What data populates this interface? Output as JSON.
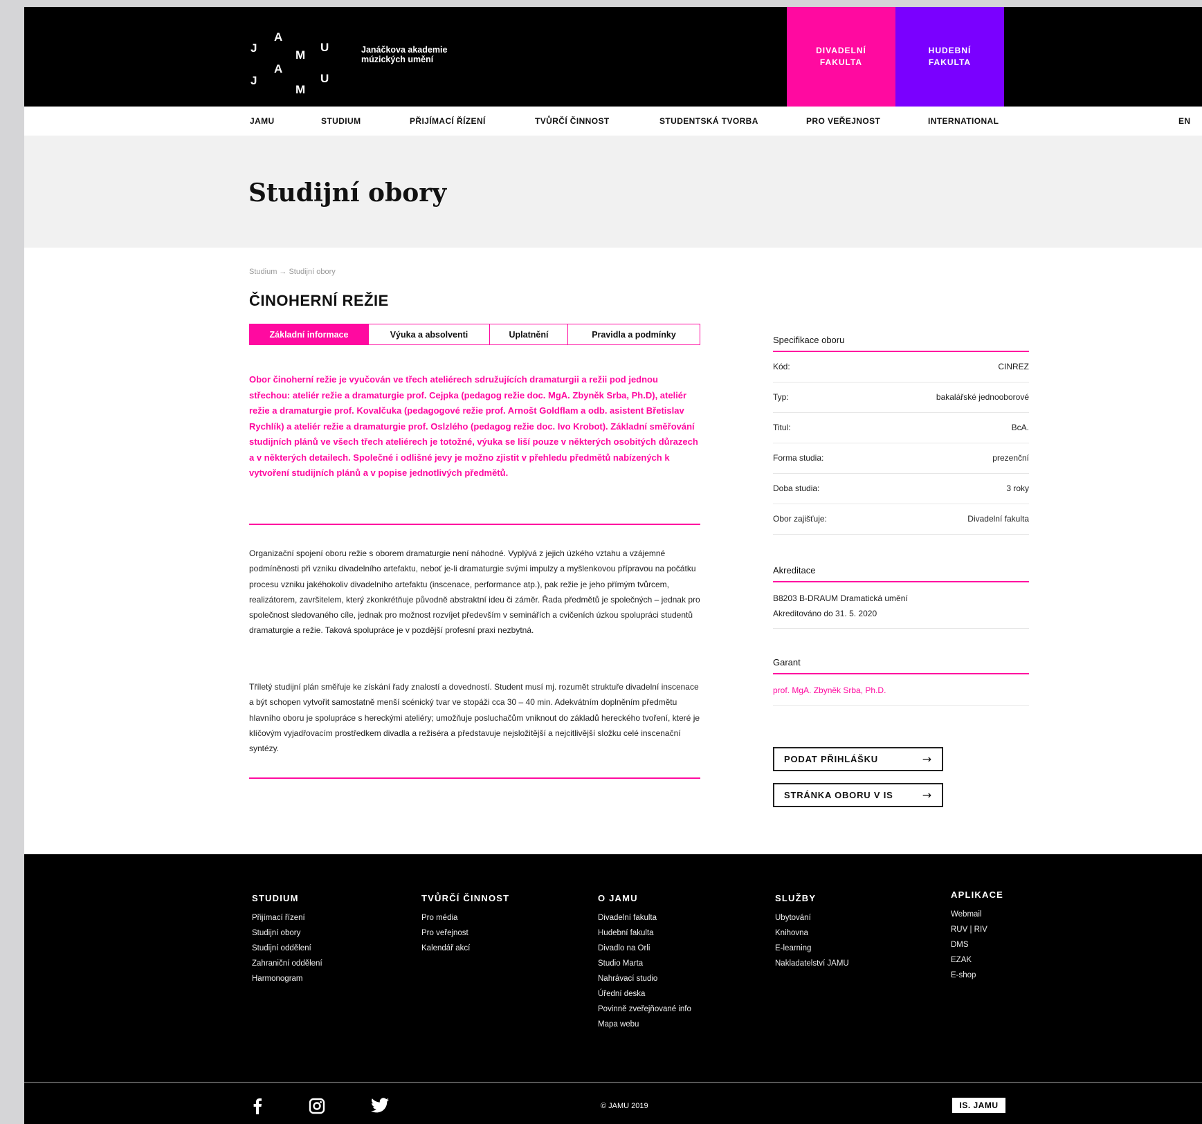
{
  "logo": {
    "letters": [
      "J",
      "A",
      "M",
      "U",
      "J",
      "A",
      "M",
      "U"
    ],
    "name_line1": "Janáčkova akademie",
    "name_line2": "múzických umění"
  },
  "faculties": {
    "theatre": [
      "DIVADELNÍ",
      "FAKULTA"
    ],
    "music": [
      "HUDEBNÍ",
      "FAKULTA"
    ]
  },
  "nav": {
    "items": [
      "JAMU",
      "STUDIUM",
      "PŘIJÍMACÍ ŘÍZENÍ",
      "TVŮRČÍ ČINNOST",
      "STUDENTSKÁ TVORBA",
      "PRO VEŘEJNOST",
      "INTERNATIONAL"
    ],
    "lang": "EN"
  },
  "hero": {
    "title": "Studijní obory"
  },
  "breadcrumb": "Studium → Studijní obory",
  "field": {
    "title": "ČINOHERNÍ REŽIE"
  },
  "tabs": [
    "Základní informace",
    "Výuka a absolventi",
    "Uplatnění",
    "Pravidla a podmínky"
  ],
  "lead": "Obor činoherní režie je vyučován ve třech ateliérech sdružujících dramaturgii a režii pod jednou střechou: ateliér režie a dramaturgie prof. Cejpka (pedagog režie doc. MgA. Zbyněk Srba, Ph.D), ateliér režie a dramaturgie prof. Kovalčuka (pedagogové režie prof. Arnošt Goldflam a odb. asistent Břetislav Rychlík) a ateliér režie a dramaturgie prof. Oslzlého (pedagog režie doc. Ivo Krobot). Základní směřování studijních plánů ve všech třech ateliérech je totožné, výuka se liší pouze v některých osobitých důrazech a v některých detailech. Společné i odlišné jevy je možno zjistit v přehledu předmětů nabízených k vytvoření studijních plánů a v popise jednotlivých předmětů.",
  "paragraphs": [
    "Organizační spojení oboru režie s oborem dramaturgie není náhodné. Vyplývá z jejich úzkého vztahu a vzájemné podmíněnosti při vzniku divadelního artefaktu, neboť je-li dramaturgie svými impulzy a myšlenkovou přípravou na počátku procesu vzniku jakéhokoliv divadelního artefaktu (inscenace, performance atp.), pak režie je jeho přímým tvůrcem, realizátorem, završitelem, který zkonkrétňuje původně abstraktní ideu či záměr. Řada předmětů je společných – jednak pro společnost sledovaného cíle, jednak pro možnost rozvíjet především v seminářích a cvičeních úzkou spolupráci studentů dramaturgie a režie. Taková spolupráce je v pozdější profesní praxi nezbytná.",
    "Tříletý studijní plán směřuje ke získání řady znalostí a dovedností. Student musí mj. rozumět struktuře divadelní inscenace a být schopen vytvořit samostatně menší scénický tvar ve stopáži cca 30 – 40 min. Adekvátním doplněním předmětu hlavního oboru je spolupráce s hereckými ateliéry; umožňuje posluchačům vniknout do základů hereckého tvoření, které je klíčovým vyjadřovacím prostředkem divadla a režiséra a představuje nejsložitější a nejcitlivější složku celé inscenační syntézy."
  ],
  "spec": {
    "heading": "Specifikace oboru",
    "rows": [
      {
        "label": "Kód:",
        "value": "CINREZ"
      },
      {
        "label": "Typ:",
        "value": "bakalářské jednooborové"
      },
      {
        "label": "Titul:",
        "value": "BcA."
      },
      {
        "label": "Forma studia:",
        "value": "prezenční"
      },
      {
        "label": "Doba studia:",
        "value": "3 roky"
      },
      {
        "label": "Obor zajišťuje:",
        "value": "Divadelní fakulta"
      }
    ]
  },
  "accreditation": {
    "heading": "Akreditace",
    "line1": "B8203 B-DRAUM Dramatická umění",
    "line2": "Akreditováno do 31. 5. 2020"
  },
  "garant": {
    "heading": "Garant",
    "name": "prof. MgA. Zbyněk Srba, Ph.D."
  },
  "buttons": {
    "apply": "PODAT PŘIHLÁŠKU",
    "is_page": "STRÁNKA OBORU V IS"
  },
  "footer": {
    "columns": [
      {
        "title": "STUDIUM",
        "links": [
          "Přijímací řízení",
          "Studijní obory",
          "Studijní oddělení",
          "Zahraniční oddělení",
          "Harmonogram"
        ]
      },
      {
        "title": "TVŮRČÍ ČINNOST",
        "links": [
          "Pro média",
          "Pro veřejnost",
          "Kalendář akcí"
        ]
      },
      {
        "title": "O JAMU",
        "links": [
          "Divadelní fakulta",
          "Hudební fakulta",
          "Divadlo na Orli",
          "Studio Marta",
          "Nahrávací studio",
          "Úřední deska",
          "Povinně zveřejňované info",
          "Mapa webu"
        ]
      },
      {
        "title": "SLUŽBY",
        "links": [
          "Ubytování",
          "Knihovna",
          "E-learning",
          "Nakladatelství JAMU"
        ]
      },
      {
        "title": "APLIKACE",
        "links": [
          "Webmail",
          "RUV | RIV",
          "DMS",
          "EZAK",
          "E-shop"
        ]
      }
    ],
    "copyright": "© JAMU 2019",
    "is_button": "IS. JAMU",
    "social": [
      "facebook-icon",
      "instagram-icon",
      "twitter-icon"
    ]
  },
  "colors": {
    "accent": "#ff0aa0",
    "purple": "#7a00ff",
    "black": "#000000"
  }
}
